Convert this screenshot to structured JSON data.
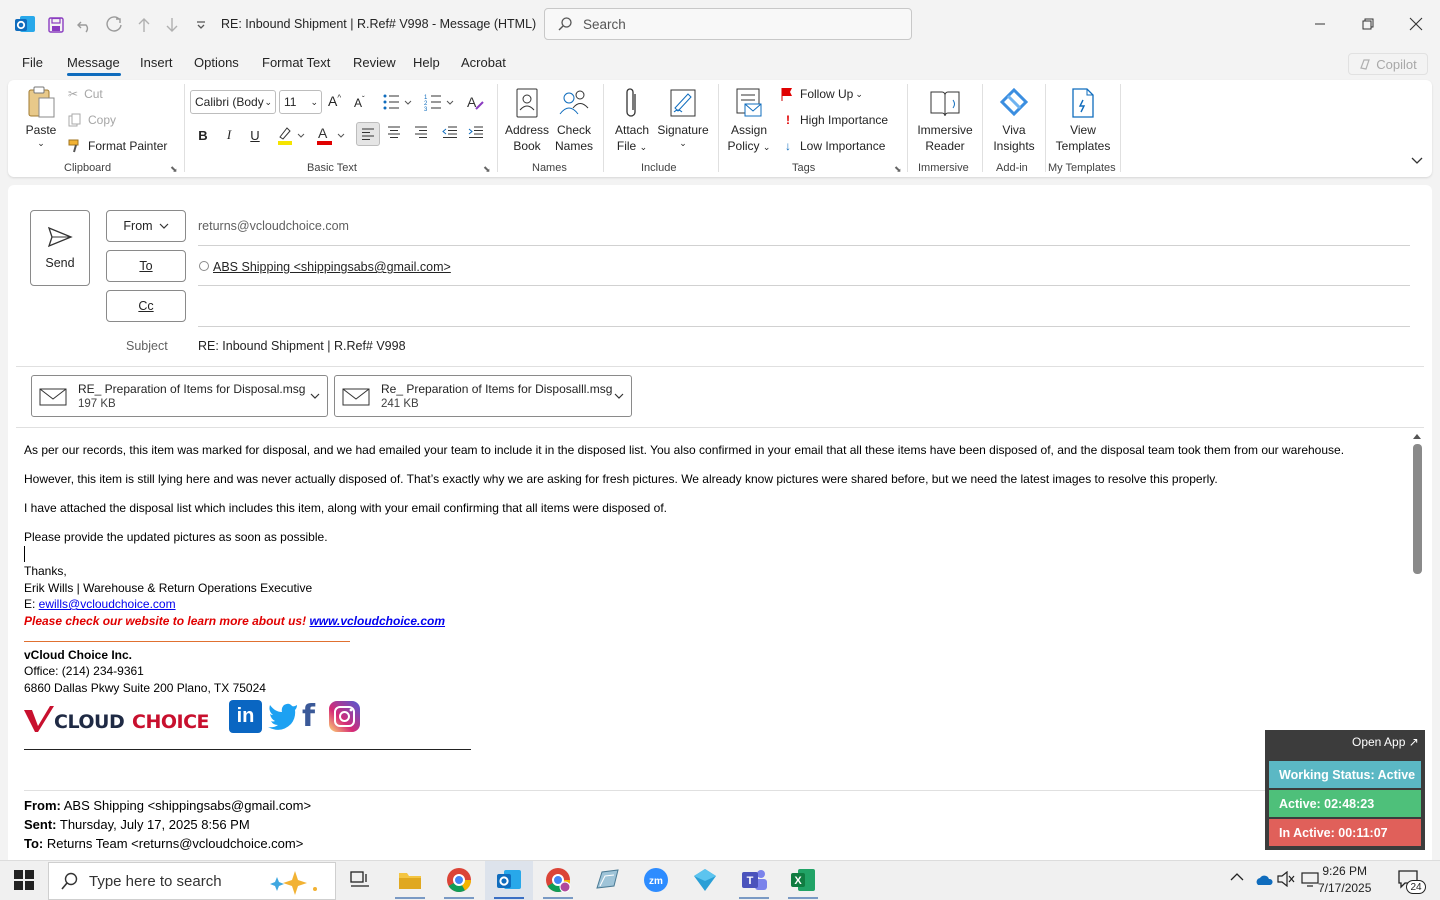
{
  "window": {
    "title": "RE: Inbound Shipment | R.Ref# V998  -  Message (HTML)",
    "search_placeholder": "Search"
  },
  "menu": {
    "file": "File",
    "message": "Message",
    "insert": "Insert",
    "options": "Options",
    "format_text": "Format Text",
    "review": "Review",
    "help": "Help",
    "acrobat": "Acrobat",
    "copilot": "Copilot"
  },
  "ribbon": {
    "paste": "Paste",
    "cut": "Cut",
    "copy": "Copy",
    "format_painter": "Format Painter",
    "clipboard_group": "Clipboard",
    "font_name": "Calibri (Body",
    "font_size": "11",
    "basic_text_group": "Basic Text",
    "address_book": [
      "Address",
      "Book"
    ],
    "check_names": [
      "Check",
      "Names"
    ],
    "names_group": "Names",
    "attach_file": [
      "Attach",
      "File"
    ],
    "signature": "Signature",
    "include_group": "Include",
    "assign_policy": [
      "Assign",
      "Policy"
    ],
    "follow_up": "Follow Up",
    "high_importance": "High Importance",
    "low_importance": "Low Importance",
    "tags_group": "Tags",
    "immersive_reader": [
      "Immersive",
      "Reader"
    ],
    "immersive_group": "Immersive",
    "viva_insights": [
      "Viva",
      "Insights"
    ],
    "addin_group": "Add-in",
    "view_templates": [
      "View",
      "Templates"
    ],
    "templates_group": "My Templates"
  },
  "header": {
    "send": "Send",
    "from_label": "From",
    "from_value": "returns@vcloudchoice.com",
    "to_label": "To",
    "to_value": "ABS Shipping <shippingsabs@gmail.com>",
    "cc_label": "Cc",
    "subject_label": "Subject",
    "subject_value": "RE: Inbound Shipment | R.Ref# V998"
  },
  "attachments": [
    {
      "name": "RE_ Preparation of Items for Disposal.msg",
      "size": "197 KB"
    },
    {
      "name": "Re_ Preparation of Items for Disposalll.msg",
      "size": "241 KB"
    }
  ],
  "body": {
    "p1": "As per our records, this item was marked for disposal, and we had emailed your team to include it in the disposed list. You also confirmed in your email that all these items have been disposed of, and the disposal team took them from our warehouse.",
    "p2": "However, this item is still lying here and was never actually disposed of. That’s exactly why we are asking for fresh pictures. We already know pictures were shared before, but we need the latest images to resolve this properly.",
    "p3": "I have attached the disposal list which includes this item, along with your email confirming that all items were disposed of.",
    "p4": "Please provide the updated pictures as soon as possible.",
    "thanks": "Thanks,",
    "sig_name": "Erik Wills | Warehouse & Return Operations Executive",
    "sig_email_prefix": "E: ",
    "sig_email": "ewills@vcloudchoice.com",
    "promo": "Please check our website to learn more about us!",
    "website": "www.vcloudchoice.com",
    "company": "vCloud Choice Inc.",
    "office": "Office: (214) 234-9361",
    "address": "6860 Dallas Pkwy Suite 200 Plano, TX 75024",
    "logo_text": "VCLOUDCHOICE"
  },
  "quoted": {
    "from_label": "From:",
    "from_value": " ABS Shipping <shippingsabs@gmail.com>",
    "sent_label": "Sent:",
    "sent_value": " Thursday, July 17, 2025 8:56 PM",
    "to_label": "To:",
    "to_value": " Returns Team <returns@vcloudchoice.com>"
  },
  "widget": {
    "open_app": "Open App ↗",
    "working_status": "Working Status: Active",
    "active": "Active: 02:48:23",
    "inactive": "In Active: 00:11:07"
  },
  "taskbar": {
    "search_placeholder": "Type here to search",
    "time": "9:26 PM",
    "date": "7/17/2025",
    "notification_count": "24"
  },
  "colors": {
    "accent": "#0f6cbd",
    "status_working": "#5bb8c4",
    "status_active": "#4ec07a",
    "status_inactive": "#e0605a",
    "logo_red": "#c8102e"
  }
}
